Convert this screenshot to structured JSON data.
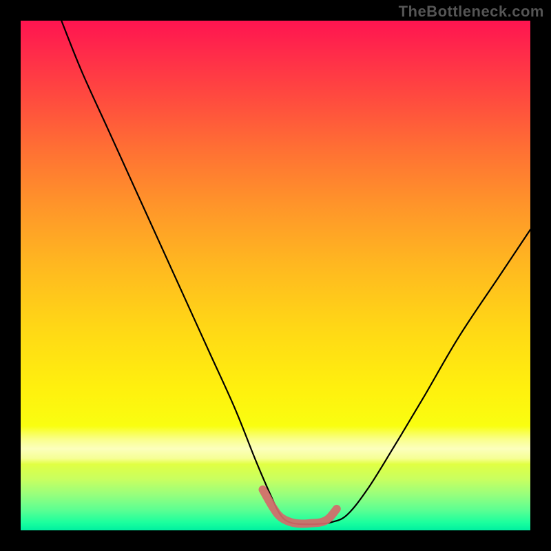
{
  "watermark": "TheBottleneck.com",
  "chart_data": {
    "type": "line",
    "title": "",
    "xlabel": "",
    "ylabel": "",
    "xlim": [
      0,
      100
    ],
    "ylim": [
      0,
      100
    ],
    "series": [
      {
        "name": "bottleneck-curve",
        "x": [
          8,
          12,
          17,
          22,
          27,
          32,
          37,
          42,
          46,
          49,
          51,
          53,
          56,
          59,
          61,
          64,
          68,
          73,
          79,
          86,
          94,
          100
        ],
        "y": [
          100,
          90,
          79,
          68,
          57,
          46,
          35,
          24,
          14,
          7,
          3,
          1.5,
          1.2,
          1.3,
          1.6,
          3,
          8,
          16,
          26,
          38,
          50,
          59
        ]
      }
    ],
    "highlight": {
      "name": "trough-marker",
      "x": [
        47.5,
        49.5,
        51,
        53,
        55,
        57,
        59,
        60.5,
        62
      ],
      "y": [
        8,
        4.5,
        2.6,
        1.6,
        1.3,
        1.4,
        1.6,
        2.4,
        4.2
      ]
    },
    "colors": {
      "curve": "#000000",
      "highlight": "#d46a6a",
      "gradient_top": "#ff1450",
      "gradient_mid": "#fff00e",
      "gradient_bottom": "#00f0a0",
      "frame": "#000000"
    }
  }
}
